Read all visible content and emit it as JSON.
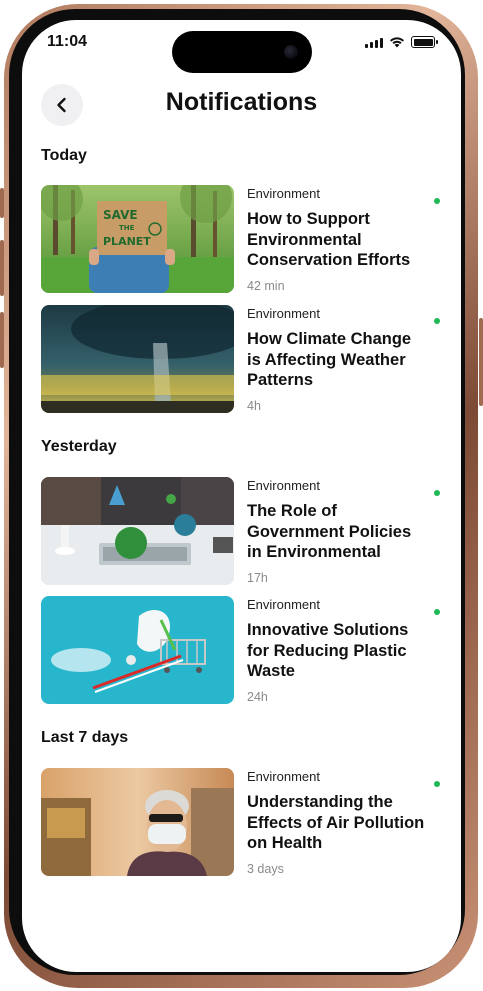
{
  "status": {
    "time": "11:04"
  },
  "header": {
    "title": "Notifications"
  },
  "sections": [
    {
      "heading": "Today"
    },
    {
      "heading": "Yesterday"
    },
    {
      "heading": "Last 7 days"
    }
  ],
  "notifications": [
    {
      "category": "Environment",
      "title": "How to Support Environmental Conservation Efforts",
      "time": "42 min",
      "sign_text": "SAVE THE PLANET",
      "unread": true
    },
    {
      "category": "Environment",
      "title": "How Climate Change is Affecting Weather Patterns",
      "time": "4h",
      "unread": true
    },
    {
      "category": "Environment",
      "title": "The Role of Government Policies in Environmental",
      "time": "17h",
      "unread": true
    },
    {
      "category": "Environment",
      "title": "Innovative Solutions for Reducing Plastic Waste",
      "time": "24h",
      "unread": true
    },
    {
      "category": "Environment",
      "title": "Understanding the Effects of Air Pollution on Health",
      "time": "3 days",
      "unread": true
    }
  ],
  "colors": {
    "unread_dot": "#1db954",
    "frame": "#b07a5d"
  }
}
